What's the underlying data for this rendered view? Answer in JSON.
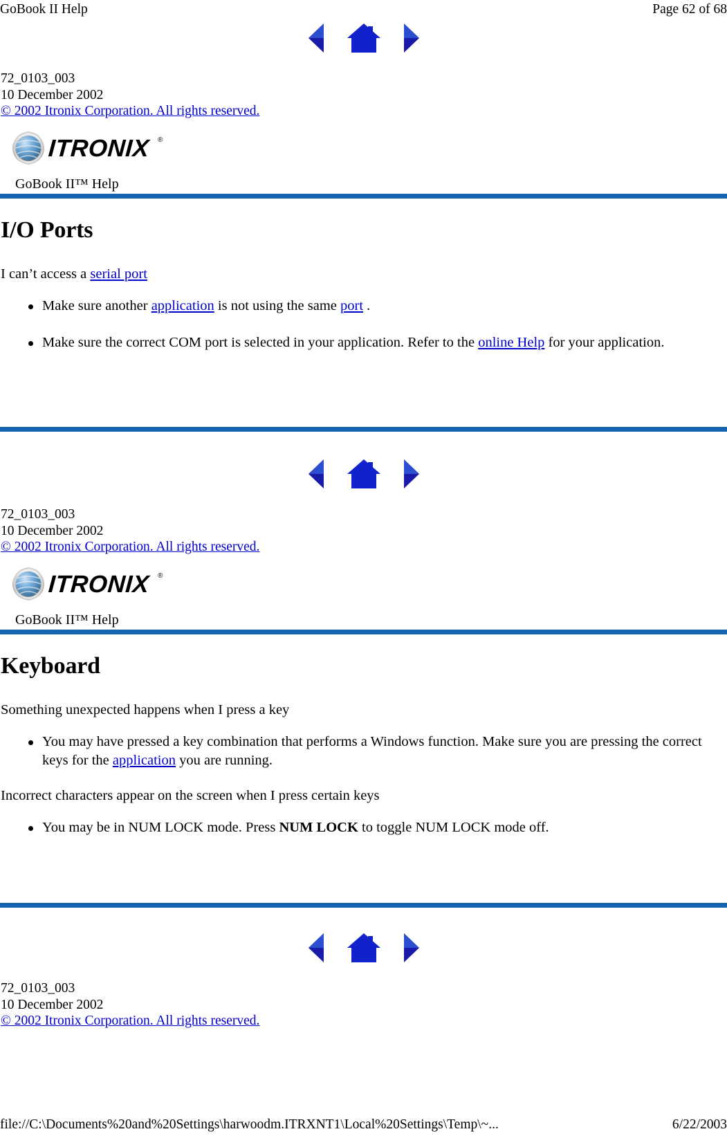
{
  "print": {
    "header_left": "GoBook II Help",
    "header_right": "Page 62 of 68",
    "footer_path": "file://C:\\Documents%20and%20Settings\\harwoodm.ITRXNT1\\Local%20Settings\\Temp\\~...",
    "footer_date": "6/22/2003"
  },
  "nav": {
    "back_label": "Back",
    "home_label": "Home",
    "forward_label": "Forward"
  },
  "meta": {
    "doc_number": "72_0103_003",
    "doc_date": "10 December 2002",
    "copyright": "© 2002 Itronix Corporation.  All rights reserved."
  },
  "logo": {
    "wordmark": "ITRONIX",
    "trademark": "®"
  },
  "help_title": "GoBook II™ Help",
  "accent_color": "#1565b0",
  "link_color": "#0000cc",
  "sections": [
    {
      "heading": "I/O Ports",
      "lead_prefix": "I can’t access a ",
      "lead_link": "serial port",
      "bullets": [
        {
          "parts": [
            {
              "type": "text",
              "text": "Make sure another "
            },
            {
              "type": "link",
              "text": "application"
            },
            {
              "type": "text",
              "text": " is not using the same "
            },
            {
              "type": "link",
              "text": "port"
            },
            {
              "type": "text",
              "text": " ."
            }
          ]
        },
        {
          "parts": [
            {
              "type": "text",
              "text": "Make sure the correct COM port is selected in your application. Refer to the "
            },
            {
              "type": "link",
              "text": "online Help"
            },
            {
              "type": "text",
              "text": " for your application."
            }
          ]
        }
      ]
    },
    {
      "heading": "Keyboard",
      "lead_a": "Something unexpected happens when I press a key",
      "lead_b": "Incorrect characters appear on the screen when I press certain keys",
      "bullets_a": [
        {
          "parts": [
            {
              "type": "text",
              "text": "You may have pressed a key combination that performs a Windows function. Make sure you are pressing the correct keys for the "
            },
            {
              "type": "link",
              "text": "application"
            },
            {
              "type": "text",
              "text": " you are running."
            }
          ]
        }
      ],
      "bullets_b": [
        {
          "parts": [
            {
              "type": "text",
              "text": "You may be in NUM LOCK mode. Press "
            },
            {
              "type": "bold",
              "text": "NUM LOCK"
            },
            {
              "type": "text",
              "text": " to toggle NUM LOCK mode off."
            }
          ]
        }
      ]
    }
  ]
}
